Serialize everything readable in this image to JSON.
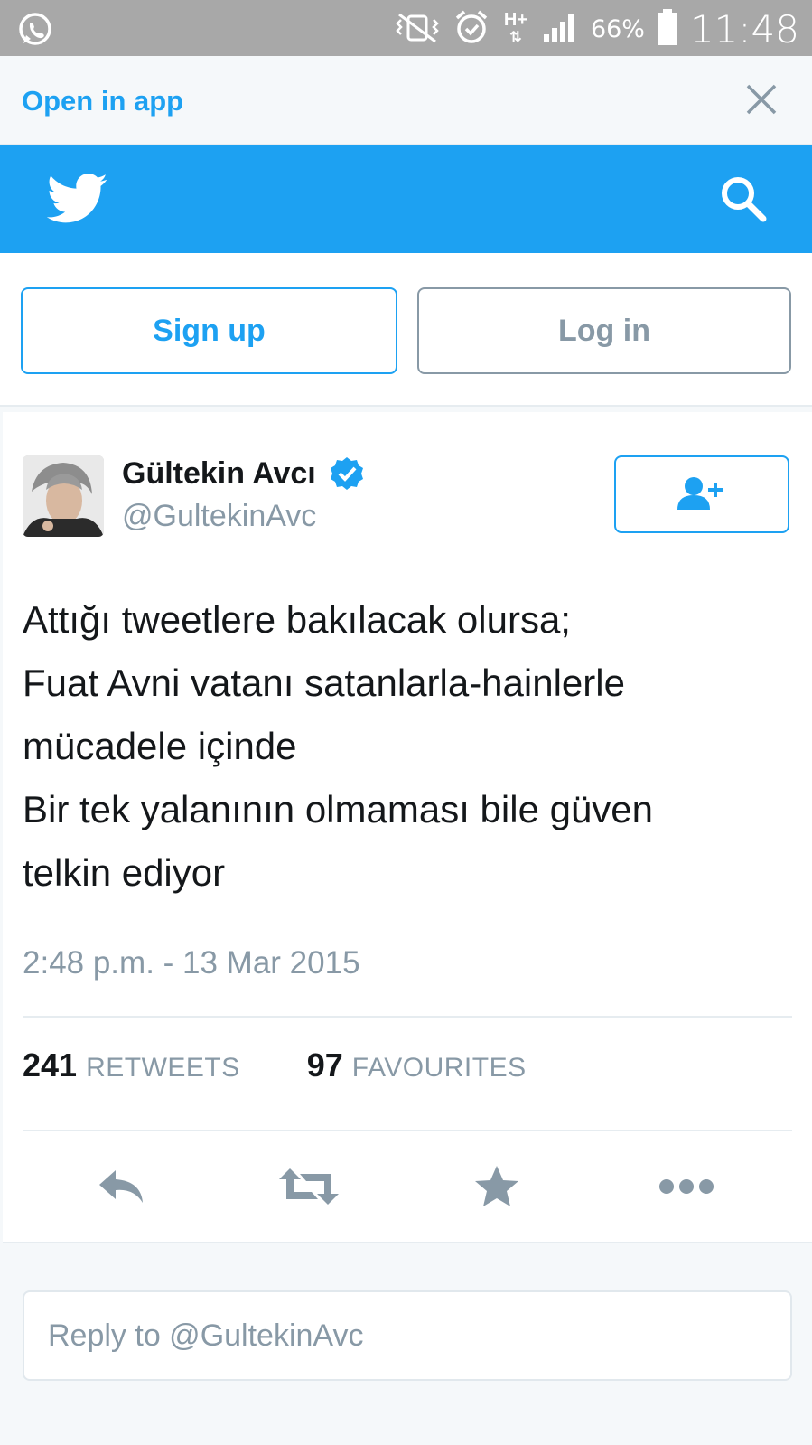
{
  "status_bar": {
    "battery": "66%",
    "time": "11:48",
    "network": "H+",
    "icons": [
      "whatsapp-icon",
      "vibrate-mute-icon",
      "alarm-icon",
      "network-icon",
      "signal-icon",
      "battery-icon"
    ]
  },
  "banner": {
    "open_in_app": "Open in app",
    "close_icon": "close-icon"
  },
  "header": {
    "logo_icon": "twitter-bird-icon",
    "search_icon": "search-icon",
    "brand_color": "#1da1f2"
  },
  "auth": {
    "signup_label": "Sign up",
    "login_label": "Log in"
  },
  "tweet": {
    "author_name": "Gültekin Avcı",
    "handle": "@GultekinAvc",
    "verified": true,
    "follow_icon": "add-user-icon",
    "text_lines": [
      "Attığı tweetlere bakılacak olursa;",
      "Fuat Avni vatanı satanlarla-hainlerle",
      "mücadele içinde",
      "Bir tek yalanının olmaması bile güven",
      "telkin ediyor"
    ],
    "timestamp": "2:48 p.m. - 13 Mar 2015",
    "retweets_count": "241",
    "retweets_label": "RETWEETS",
    "favourites_count": "97",
    "favourites_label": "FAVOURITES",
    "actions": [
      "reply-icon",
      "retweet-icon",
      "favourite-icon",
      "more-icon"
    ]
  },
  "reply": {
    "placeholder": "Reply to @GultekinAvc"
  }
}
